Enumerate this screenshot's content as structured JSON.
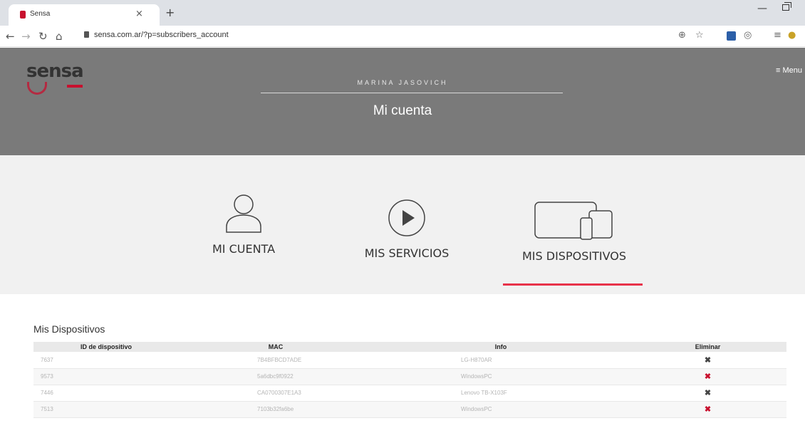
{
  "browser": {
    "tab_title": "Sensa",
    "tab_close": "×",
    "new_tab": "+",
    "url": "sensa.com.ar/?p=subscribers_account",
    "window_minimize": "—"
  },
  "header": {
    "logo_text": "sensa",
    "menu_label": "≡ Menu",
    "user_name": "MARINA JASOVICH",
    "title": "Mi cuenta"
  },
  "nav": [
    {
      "label": "MI CUENTA",
      "icon": "user-icon"
    },
    {
      "label": "MIS SERVICIOS",
      "icon": "play-icon"
    },
    {
      "label": "MIS DISPOSITIVOS",
      "icon": "devices-icon",
      "active": true
    }
  ],
  "devices": {
    "title": "Mis Dispositivos",
    "columns": [
      "ID de dispositivo",
      "MAC",
      "Info",
      "Eliminar"
    ],
    "rows": [
      {
        "id": "7637",
        "mac": "7B4BFBCD7ADE",
        "info": "LG-H870AR",
        "delete": "✖"
      },
      {
        "id": "9573",
        "mac": "5a6dbc9f0922",
        "info": "WindowsPC",
        "delete": "✖"
      },
      {
        "id": "7446",
        "mac": "CA0700307E1A3",
        "info": "Lenovo TB-X103F",
        "delete": "✖"
      },
      {
        "id": "7513",
        "mac": "7103b32fa6be",
        "info": "WindowsPC",
        "delete": "✖"
      }
    ]
  },
  "colors": {
    "accent": "#e8334a",
    "header_bg": "#7a7a7a",
    "nav_bg": "#f1f1f1"
  }
}
